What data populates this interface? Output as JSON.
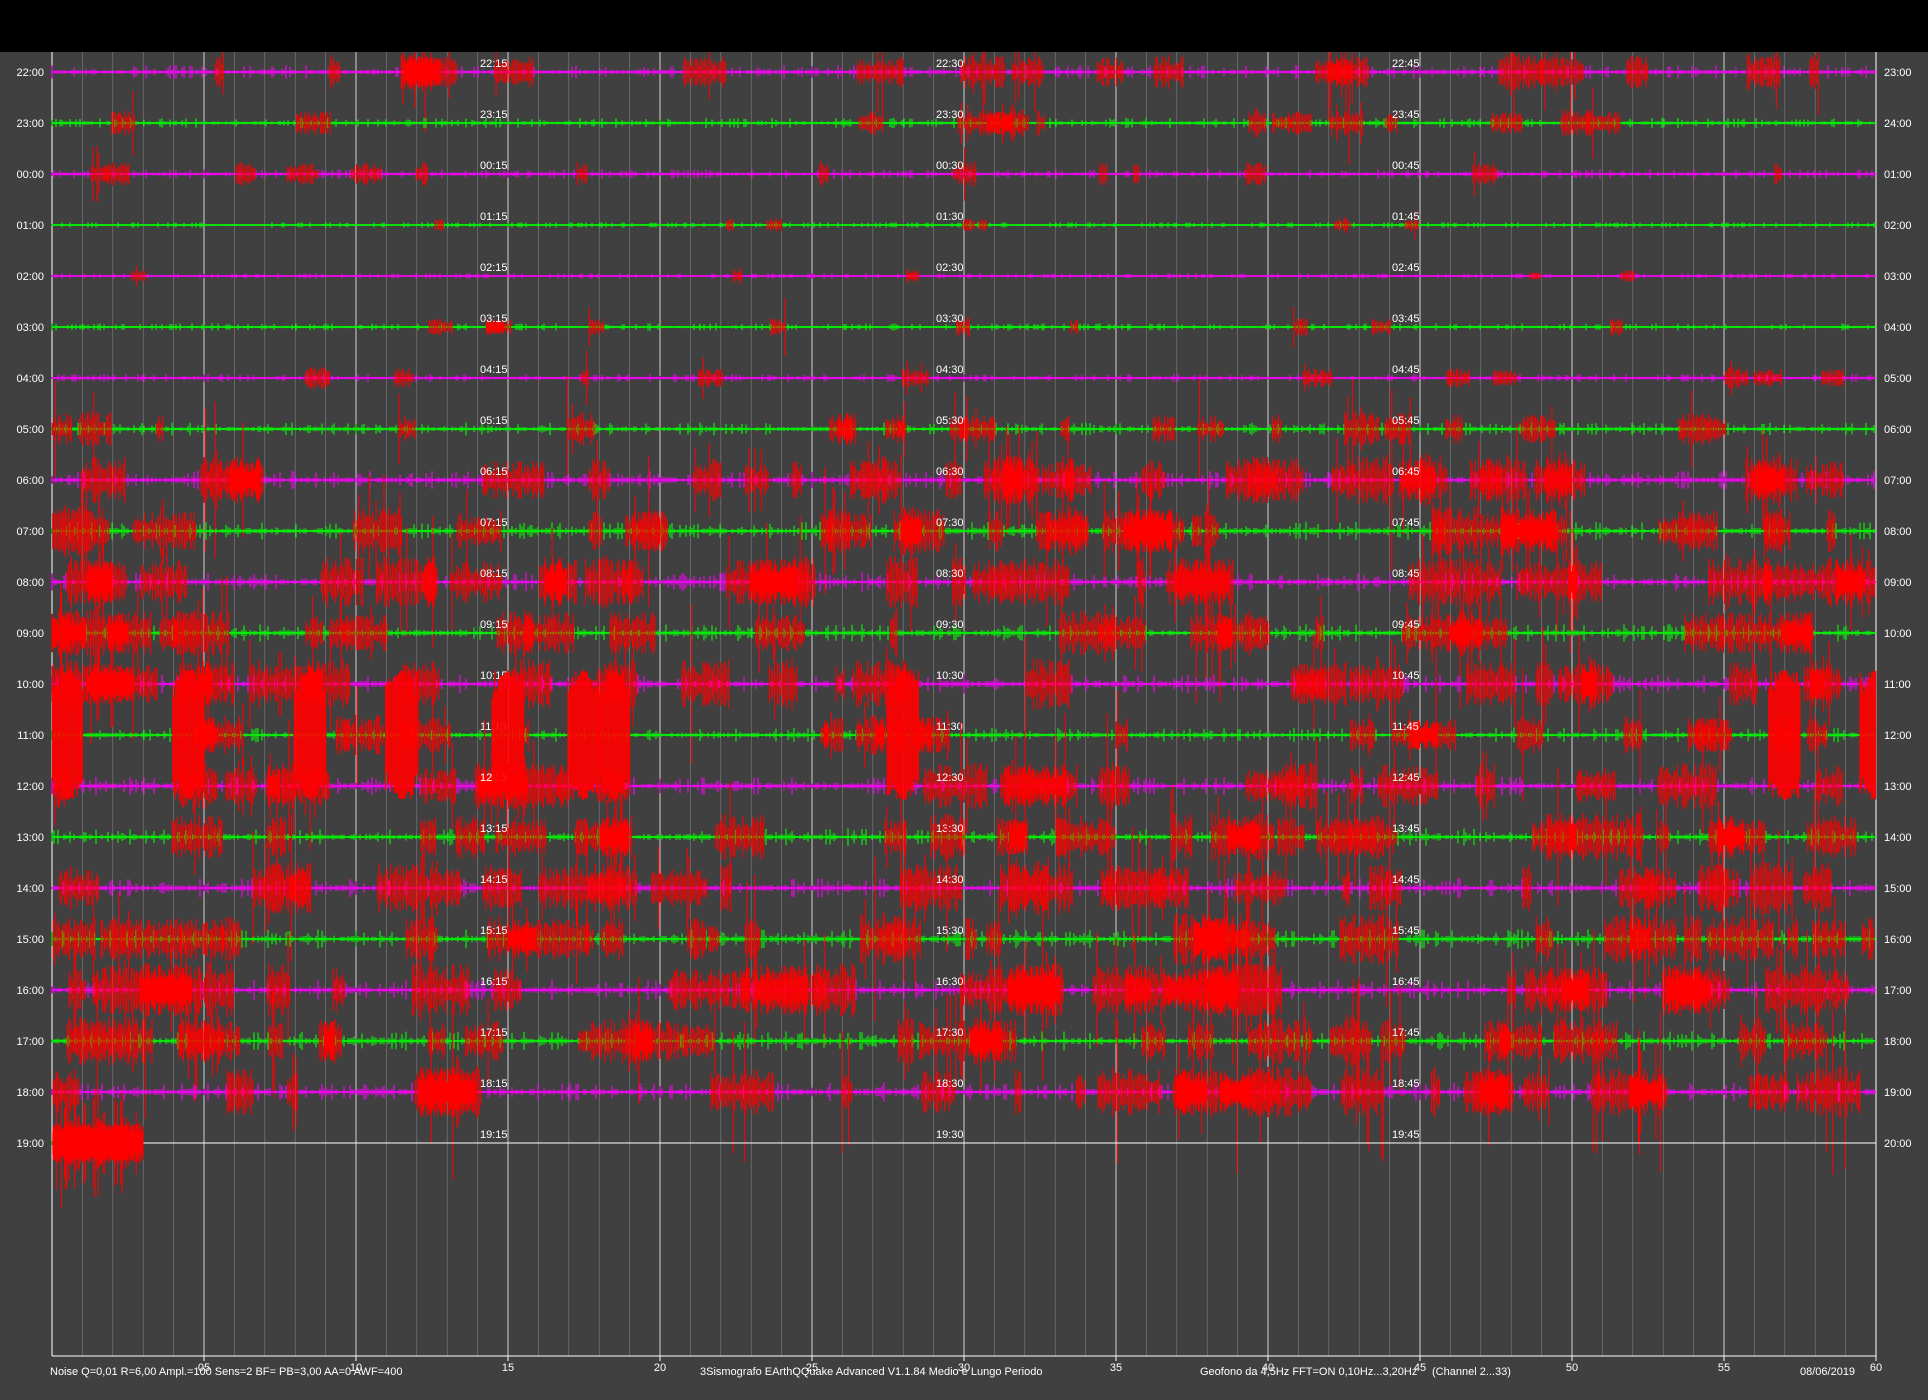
{
  "window": {
    "title": "3Sismografo EArthQQuake Advanced V1.1.84 Medio e Lungo Periodo"
  },
  "footer": {
    "left": "Noise Q=0,01 R=6,00 Ampl.=100 Sens=2 BF= PB=3,00 AA=0 AWF=400",
    "center": "3Sismografo  EArthQQuake Advanced V1.1.84  Medio e Lungo Periodo",
    "right_sensor": "Geofono da 4,5Hz FFT=ON 0,10Hz...3,20Hz",
    "right_channel": "(Channel 2...33)",
    "date": "08/06/2019"
  },
  "colors": {
    "background": "#404040",
    "grid": "#b8b8b8",
    "grid_major": "#e0e0e0",
    "trace_magenta": "#ff00ff",
    "trace_green": "#00ff00",
    "event_red": "#ff0000",
    "text": "#ffffff"
  },
  "chart_data": {
    "type": "helicorder",
    "xlabel": "",
    "x_ticks": [
      "05",
      "10",
      "15",
      "20",
      "25",
      "30",
      "35",
      "40",
      "45",
      "50",
      "55",
      "60"
    ],
    "xlim": [
      0,
      60
    ],
    "rows": [
      {
        "left": "22:00",
        "right": "23:00",
        "marks": [
          "22:15",
          "22:30",
          "22:45"
        ],
        "color": "magenta",
        "activity": 0.55
      },
      {
        "left": "23:00",
        "right": "24:00",
        "marks": [
          "23:15",
          "23:30",
          "23:45"
        ],
        "color": "green",
        "activity": 0.35
      },
      {
        "left": "00:00",
        "right": "01:00",
        "marks": [
          "00:15",
          "00:30",
          "00:45"
        ],
        "color": "magenta",
        "activity": 0.3
      },
      {
        "left": "01:00",
        "right": "02:00",
        "marks": [
          "01:15",
          "01:30",
          "01:45"
        ],
        "color": "green",
        "activity": 0.08
      },
      {
        "left": "02:00",
        "right": "03:00",
        "marks": [
          "02:15",
          "02:30",
          "02:45"
        ],
        "color": "magenta",
        "activity": 0.06
      },
      {
        "left": "03:00",
        "right": "04:00",
        "marks": [
          "03:15",
          "03:30",
          "03:45"
        ],
        "color": "green",
        "activity": 0.18
      },
      {
        "left": "04:00",
        "right": "05:00",
        "marks": [
          "04:15",
          "04:30",
          "04:45"
        ],
        "color": "magenta",
        "activity": 0.22
      },
      {
        "left": "05:00",
        "right": "06:00",
        "marks": [
          "05:15",
          "05:30",
          "05:45"
        ],
        "color": "green",
        "activity": 0.5
      },
      {
        "left": "06:00",
        "right": "07:00",
        "marks": [
          "06:15",
          "06:30",
          "06:45"
        ],
        "color": "magenta",
        "activity": 0.8
      },
      {
        "left": "07:00",
        "right": "08:00",
        "marks": [
          "07:15",
          "07:30",
          "07:45"
        ],
        "color": "green",
        "activity": 0.8
      },
      {
        "left": "08:00",
        "right": "09:00",
        "marks": [
          "08:15",
          "08:30",
          "08:45"
        ],
        "color": "magenta",
        "activity": 0.85
      },
      {
        "left": "09:00",
        "right": "10:00",
        "marks": [
          "09:15",
          "09:30",
          "09:45"
        ],
        "color": "green",
        "activity": 0.75
      },
      {
        "left": "10:00",
        "right": "11:00",
        "marks": [
          "10:15",
          "10:30",
          "10:45"
        ],
        "color": "magenta",
        "activity": 0.85
      },
      {
        "left": "11:00",
        "right": "12:00",
        "marks": [
          "11:15",
          "11:30",
          "11:45"
        ],
        "color": "green",
        "activity": 0.6
      },
      {
        "left": "12:00",
        "right": "13:00",
        "marks": [
          "12:15",
          "12:30",
          "12:45"
        ],
        "color": "magenta",
        "activity": 0.8
      },
      {
        "left": "13:00",
        "right": "14:00",
        "marks": [
          "13:15",
          "13:30",
          "13:45"
        ],
        "color": "green",
        "activity": 0.75
      },
      {
        "left": "14:00",
        "right": "15:00",
        "marks": [
          "14:15",
          "14:30",
          "14:45"
        ],
        "color": "magenta",
        "activity": 0.85
      },
      {
        "left": "15:00",
        "right": "16:00",
        "marks": [
          "15:15",
          "15:30",
          "15:45"
        ],
        "color": "green",
        "activity": 0.85
      },
      {
        "left": "16:00",
        "right": "17:00",
        "marks": [
          "16:15",
          "16:30",
          "16:45"
        ],
        "color": "magenta",
        "activity": 0.9
      },
      {
        "left": "17:00",
        "right": "18:00",
        "marks": [
          "17:15",
          "17:30",
          "17:45"
        ],
        "color": "green",
        "activity": 0.85
      },
      {
        "left": "18:00",
        "right": "19:00",
        "marks": [
          "18:15",
          "18:30",
          "18:45"
        ],
        "color": "magenta",
        "activity": 0.85
      },
      {
        "left": "19:00",
        "right": "20:00",
        "marks": [
          "19:15",
          "19:30",
          "19:45"
        ],
        "color": "green",
        "activity": 0.7,
        "trace_end_minute": 3
      }
    ],
    "big_events_row_range": [
      "10:00",
      "12:00"
    ],
    "big_events_minutes": [
      0.5,
      4.5,
      8.5,
      11.5,
      15,
      17.5,
      18.5,
      28,
      57,
      60
    ]
  }
}
